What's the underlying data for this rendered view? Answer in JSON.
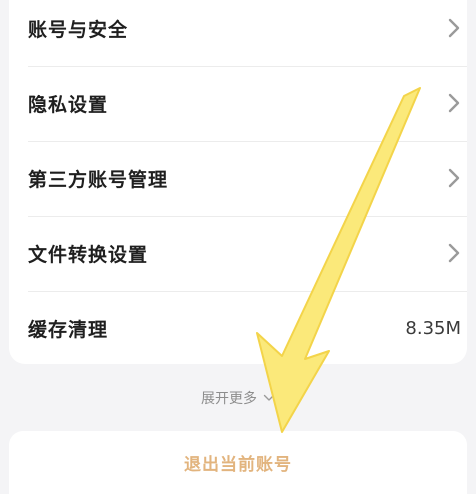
{
  "settings": {
    "items": [
      {
        "label": "账号与安全",
        "has_chevron": true
      },
      {
        "label": "隐私设置",
        "has_chevron": true
      },
      {
        "label": "第三方账号管理",
        "has_chevron": true
      },
      {
        "label": "文件转换设置",
        "has_chevron": true
      },
      {
        "label": "缓存清理",
        "value": "8.35M"
      }
    ]
  },
  "expand": {
    "label": "展开更多",
    "icon": "chevron-down-icon"
  },
  "logout": {
    "label": "退出当前账号"
  },
  "colors": {
    "background": "#f4f4f6",
    "card": "#ffffff",
    "logout_text": "#e2b47e",
    "arrow_fill": "#fbe97a",
    "chevron": "#9a9a9a"
  }
}
